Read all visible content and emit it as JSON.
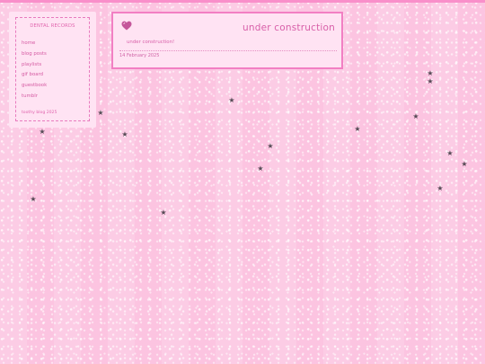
{
  "sidebar": {
    "title": "DENTAL RECORDS",
    "items": [
      {
        "label": "home"
      },
      {
        "label": "blog posts"
      },
      {
        "label": "playlists"
      },
      {
        "label": "gif board"
      },
      {
        "label": "guestbook"
      },
      {
        "label": "tumblr"
      }
    ],
    "footer": "toothy blog 2025"
  },
  "post": {
    "icon": "heart-icon",
    "title": "under construction",
    "body": "under construction!",
    "date": "14 February 2025"
  },
  "colors": {
    "background": "#fcc8e3",
    "panel": "#ffe3f3",
    "accent": "#f27fc3",
    "text": "#d85fa8",
    "star": "#554a55"
  }
}
